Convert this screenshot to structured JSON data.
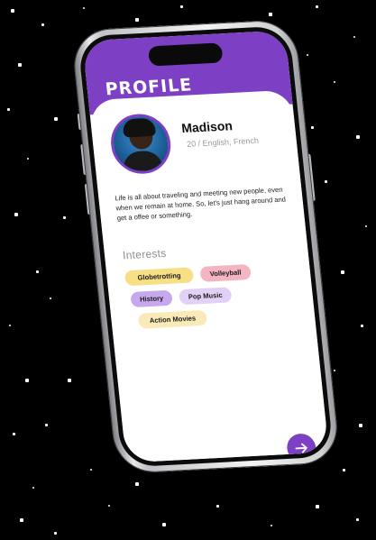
{
  "screen": {
    "title": "PROFILE"
  },
  "profile": {
    "name": "Madison",
    "age_languages": "20 / English, French",
    "bio": "Life is all about traveling and meeting new people, even when we remain at home. So, let's just hang around and get a offee or something."
  },
  "interests": {
    "heading": "Interests",
    "items": [
      {
        "label": "Globetrotting",
        "color": "#f7df86"
      },
      {
        "label": "Volleyball",
        "color": "#f4b4c2"
      },
      {
        "label": "History",
        "color": "#c7a7ee"
      },
      {
        "label": "Pop Music",
        "color": "#e2d1f7"
      },
      {
        "label": "Action Movies",
        "color": "#faeab8"
      }
    ]
  },
  "colors": {
    "accent": "#7d3fc3",
    "background": "#000000"
  },
  "icons": {
    "next": "arrow-right-icon",
    "avatar": "profile-photo"
  }
}
